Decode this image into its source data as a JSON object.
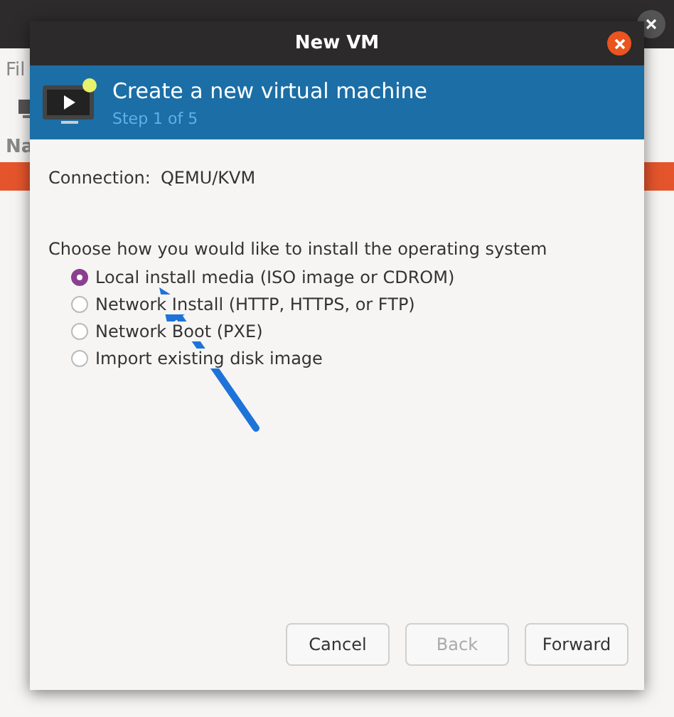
{
  "background_window": {
    "menu_label": "Fil",
    "column_label": "Na"
  },
  "dialog": {
    "title": "New VM",
    "header": {
      "title": "Create a new virtual machine",
      "step": "Step 1 of 5"
    },
    "connection": {
      "label": "Connection:",
      "value": "QEMU/KVM"
    },
    "prompt": "Choose how you would like to install the operating system",
    "options": [
      {
        "label": "Local install media (ISO image or CDROM)",
        "selected": true
      },
      {
        "label": "Network Install (HTTP, HTTPS, or FTP)",
        "selected": false
      },
      {
        "label": "Network Boot (PXE)",
        "selected": false
      },
      {
        "label": "Import existing disk image",
        "selected": false
      }
    ],
    "buttons": [
      {
        "label": "Cancel",
        "disabled": false
      },
      {
        "label": "Back",
        "disabled": true
      },
      {
        "label": "Forward",
        "disabled": false
      }
    ]
  }
}
